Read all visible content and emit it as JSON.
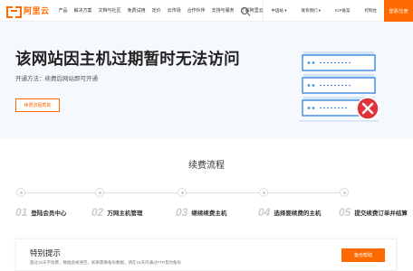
{
  "header": {
    "logo_text": "阿里云",
    "nav": [
      "产品",
      "解决方案",
      "文档与社区",
      "免费试用",
      "定价",
      "云市场",
      "合作伙伴",
      "支持与服务",
      "了解阿里云"
    ],
    "right_items": [
      "中国站",
      "联系我们",
      "ICP备案",
      "控制台"
    ],
    "cta": "登录/注册"
  },
  "hero": {
    "title": "该网站因主机过期暂时无法访问",
    "subtitle": "开通方法：续费后网站即可开通",
    "button": "续费流程帮助"
  },
  "steps": {
    "title": "续费流程",
    "items": [
      {
        "num": "01",
        "label": "登陆会员中心"
      },
      {
        "num": "02",
        "label": "万网主机管理"
      },
      {
        "num": "03",
        "label": "继续续费主机"
      },
      {
        "num": "04",
        "label": "选择要续费的主机"
      },
      {
        "num": "05",
        "label": "提交续费订单并结算"
      }
    ]
  },
  "notice": {
    "title": "特别提示",
    "text": "超过15天不续费，数据会被清空，如果需要备份数据，请在15天内通过FTP及时备份",
    "button": "备份帮助"
  },
  "colors": {
    "accent": "#ff6a00",
    "hero_bg": "#f5f8fc",
    "illustration_blue": "#4a90e2",
    "error_red": "#e0323a"
  }
}
